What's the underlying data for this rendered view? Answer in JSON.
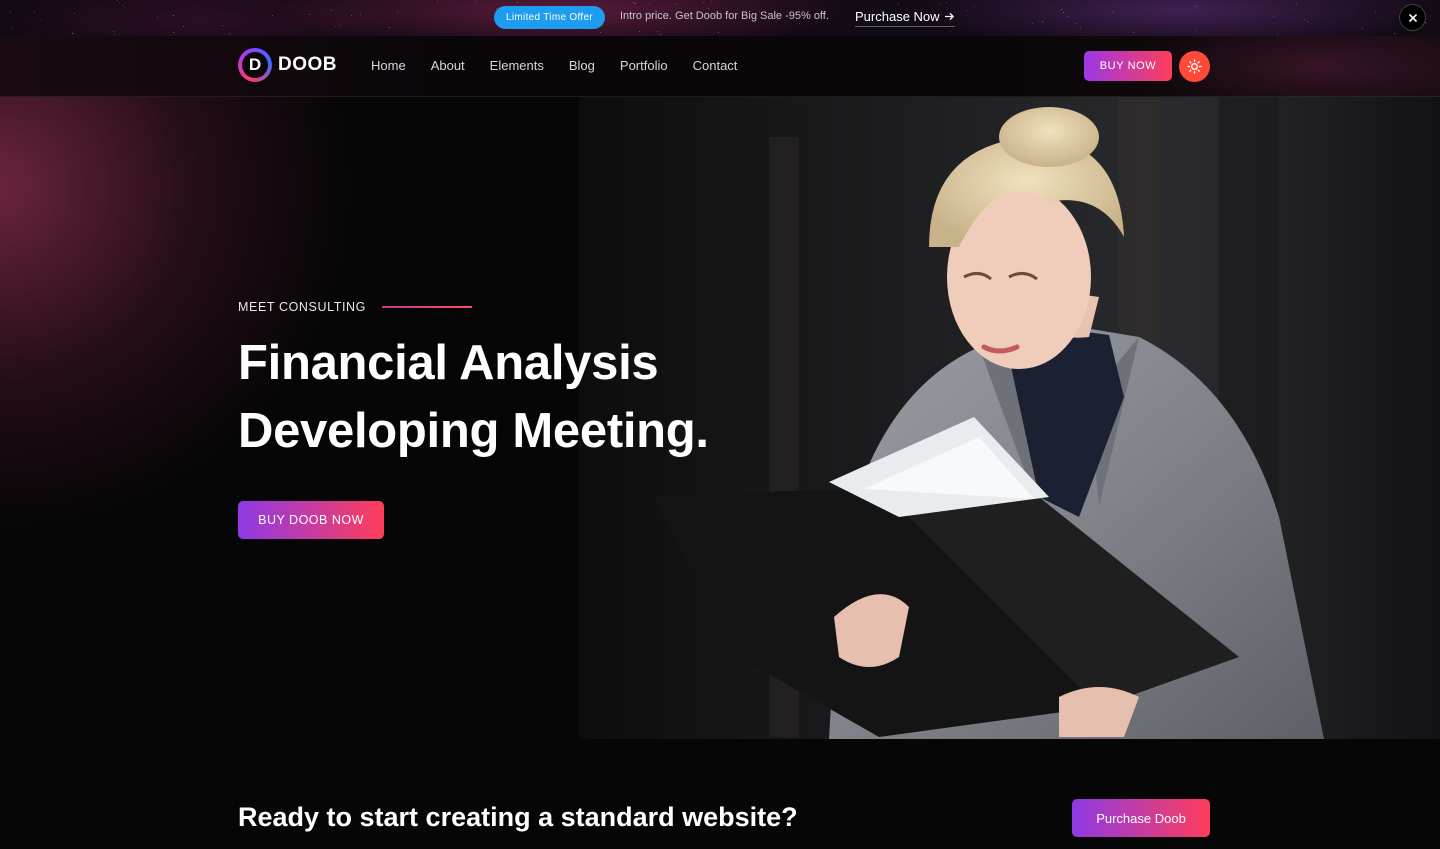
{
  "promo": {
    "badge": "Limited Time Offer",
    "text": "Intro price. Get Doob for Big Sale -95% off.",
    "link": "Purchase Now"
  },
  "header": {
    "logo_mark": "D",
    "logo_text": "DOOB",
    "nav": [
      "Home",
      "About",
      "Elements",
      "Blog",
      "Portfolio",
      "Contact"
    ],
    "buy_label": "BUY NOW"
  },
  "hero": {
    "eyebrow": "MEET CONSULTING",
    "headline_line1": "Financial Analysis",
    "headline_line2": "Developing Meeting.",
    "button": "BUY DOOB NOW"
  },
  "cta": {
    "title": "Ready to start creating a standard website?",
    "button": "Purchase Doob"
  },
  "colors": {
    "badge": "#1e9cf0",
    "gradient_start": "#8e3ae6",
    "gradient_end": "#ff3d5a",
    "theme_button": "#ff4a3a",
    "eyebrow_line": "#c23b8f"
  },
  "icons": {
    "close": "close-icon",
    "theme": "sun-icon",
    "arrow": "arrow-right-icon"
  }
}
